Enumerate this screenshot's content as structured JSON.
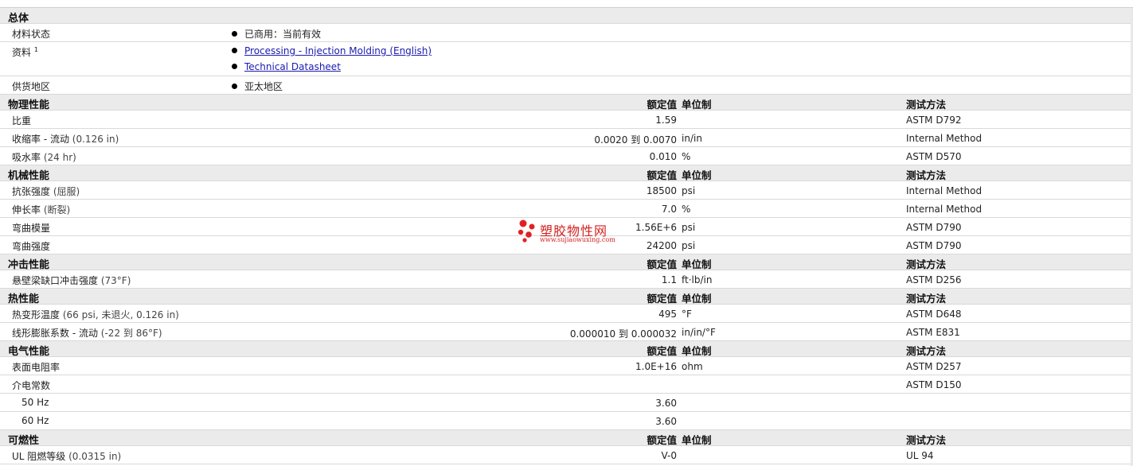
{
  "headers": {
    "rated": "额定值",
    "unit": "单位制",
    "test": "测试方法"
  },
  "general": {
    "title": "总体",
    "material_status": {
      "label": "材料状态",
      "value": "已商用：当前有效"
    },
    "resources": {
      "label": "资料",
      "footnote": "1",
      "links": [
        "Processing - Injection Molding (English)",
        "Technical Datasheet"
      ]
    },
    "availability": {
      "label": "供货地区",
      "value": "亚太地区"
    }
  },
  "sections": [
    {
      "title": "物理性能",
      "rows": [
        {
          "name": "比重",
          "cond": "",
          "value": "1.59",
          "unit": "",
          "method": "ASTM D792"
        },
        {
          "name": "收缩率  - 流动",
          "cond": "(0.126 in)",
          "value": "0.0020 到  0.0070",
          "unit": "in/in",
          "method": "Internal Method"
        },
        {
          "name": "吸水率",
          "cond": "(24 hr)",
          "value": "0.010",
          "unit": "%",
          "method": "ASTM D570"
        }
      ]
    },
    {
      "title": "机械性能",
      "rows": [
        {
          "name": "抗张强度",
          "cond": "(屈服)",
          "value": "18500",
          "unit": "psi",
          "method": "Internal Method"
        },
        {
          "name": "伸长率",
          "cond": "(断裂)",
          "value": "7.0",
          "unit": "%",
          "method": "Internal Method"
        },
        {
          "name": "弯曲模量",
          "cond": "",
          "value": "1.56E+6",
          "unit": "psi",
          "method": "ASTM D790"
        },
        {
          "name": "弯曲强度",
          "cond": "",
          "value": "24200",
          "unit": "psi",
          "method": "ASTM D790"
        }
      ]
    },
    {
      "title": "冲击性能",
      "rows": [
        {
          "name": "悬壁梁缺口冲击强度",
          "cond": "(73°F)",
          "value": "1.1",
          "unit": "ft·lb/in",
          "method": "ASTM D256"
        }
      ]
    },
    {
      "title": "热性能",
      "rows": [
        {
          "name": "热变形温度",
          "cond": "(66 psi, 未退火, 0.126 in)",
          "value": "495",
          "unit": "°F",
          "method": "ASTM D648"
        },
        {
          "name": "线形膨胀系数  - 流动",
          "cond": "(-22 到  86°F)",
          "value": "0.000010 到  0.000032",
          "unit": "in/in/°F",
          "method": "ASTM E831"
        }
      ]
    },
    {
      "title": "电气性能",
      "rows": [
        {
          "name": "表面电阻率",
          "cond": "",
          "value": "1.0E+16",
          "unit": "ohm",
          "method": "ASTM D257"
        },
        {
          "name": "介电常数",
          "cond": "",
          "value": "",
          "unit": "",
          "method": "ASTM D150"
        },
        {
          "name": "50 Hz",
          "cond": "",
          "value": "3.60",
          "unit": "",
          "method": "",
          "sub": true
        },
        {
          "name": "60 Hz",
          "cond": "",
          "value": "3.60",
          "unit": "",
          "method": "",
          "sub": true
        }
      ]
    },
    {
      "title": "可燃性",
      "rows": [
        {
          "name": "UL 阻燃等级",
          "cond": "(0.0315 in)",
          "value": "V-0",
          "unit": "",
          "method": "UL 94"
        }
      ]
    }
  ],
  "watermark": {
    "name": "塑胶物性网",
    "url": "www.sujiaowuxing.com",
    "color": "#d42020"
  }
}
